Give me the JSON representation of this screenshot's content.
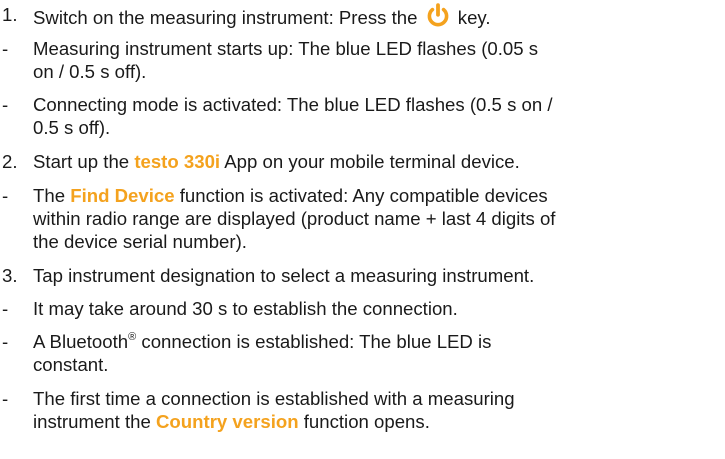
{
  "colors": {
    "text": "#1a1a1a",
    "highlight": "#f4a21e",
    "power_icon": "#f4a21e"
  },
  "steps": {
    "s1": {
      "marker": "1.",
      "before": "Switch on the measuring instrument: Press the",
      "icon": "power-icon",
      "after": "key."
    },
    "b1": {
      "marker": "-",
      "line1": "Measuring instrument starts up: The blue LED flashes (0.05 s",
      "line2": "on / 0.5 s off)."
    },
    "b2": {
      "marker": "-",
      "line1": "Connecting mode is activated: The blue LED flashes (0.5 s on /",
      "line2": "0.5 s off)."
    },
    "s2": {
      "marker": "2.",
      "before": "Start up the",
      "highlight": "testo 330i",
      "after": "App on your mobile terminal device."
    },
    "b3": {
      "marker": "-",
      "line1_before": "The",
      "line1_highlight": "Find Device",
      "line1_after": "function is activated: Any compatible devices",
      "line2": "within radio range are displayed (product name + last 4 digits of",
      "line3": "the device serial number)."
    },
    "s3": {
      "marker": "3.",
      "text": "Tap instrument designation to select a measuring instrument."
    },
    "b4": {
      "marker": "-",
      "text": "It may take around 30 s to establish the connection."
    },
    "b5": {
      "marker": "-",
      "line1_before": "A Bluetooth",
      "line1_sup": "®",
      "line1_after": "connection is established: The blue LED is",
      "line2": "constant."
    },
    "b6": {
      "marker": "-",
      "line1": "The first time a connection is established with a measuring",
      "line2_before": "instrument the",
      "line2_highlight": "Country version",
      "line2_after": "function opens."
    }
  }
}
